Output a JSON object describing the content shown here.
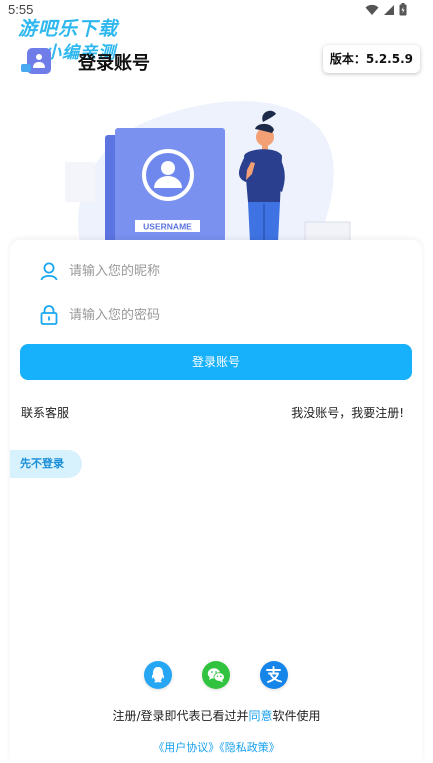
{
  "status_bar": {
    "time": "5:55"
  },
  "watermark": {
    "line1": "游吧乐下载",
    "line2": "小编亲测"
  },
  "header": {
    "title": "登录账号",
    "version": "版本：5.2.5.9"
  },
  "illustration": {
    "card_label": "USERNAME"
  },
  "form": {
    "username_placeholder": "请输入您的昵称",
    "password_placeholder": "请输入您的密码",
    "login_button": "登录账号",
    "contact_service": "联系客服",
    "register_link": "我没账号，我要注册!",
    "skip_login": "先不登录"
  },
  "social": [
    {
      "name": "qq",
      "color": "#27a6f3"
    },
    {
      "name": "wechat",
      "color": "#31c23f"
    },
    {
      "name": "alipay",
      "color": "#1585ea"
    }
  ],
  "agreement": {
    "prefix": "注册/登录即代表已看过并",
    "agree": "同意",
    "suffix": "软件使用",
    "user_agreement": "《用户协议》",
    "privacy_policy": "《隐私政策》"
  },
  "colors": {
    "accent": "#16b0fb",
    "skip_bg": "#d7f1fd",
    "link": "#18a0ee"
  }
}
